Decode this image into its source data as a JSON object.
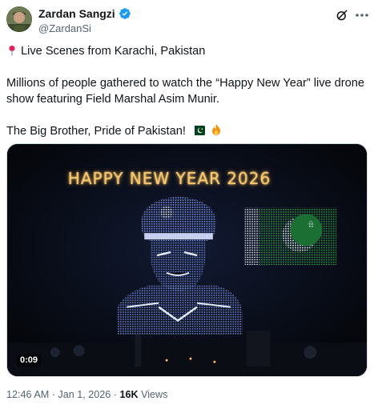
{
  "author": {
    "display_name": "Zardan Sangzi",
    "handle": "@ZardanSi",
    "avatar_icon": "avatar-portrait",
    "verified_icon": "verified-badge-icon",
    "verified_color": "#1d9bf0"
  },
  "actions": {
    "grok_icon": "grok-icon",
    "more_icon": "more-options-icon"
  },
  "post": {
    "line1": "Live Scenes from Karachi, Pakistan",
    "line2": "Millions of people gathered to watch the “Happy New Year” live drone",
    "line3": "show featuring Field Marshal Asim Munir.",
    "line4": "The Big Brother, Pride of Pakistan!",
    "emojis": [
      "pakistan-flag-emoji",
      "fire-emoji"
    ]
  },
  "media": {
    "drone_text": "HAPPY NEW YEAR 2026",
    "duration": "0:09"
  },
  "footer": {
    "time": "12:46 AM",
    "separator": "·",
    "date": "Jan 1, 2026",
    "views_count": "16K",
    "views_label": "Views"
  },
  "colors": {
    "accent": "#1d9bf0",
    "text_primary": "#0f1419",
    "text_secondary": "#536471",
    "drone_blue": "#6f8cff",
    "drone_gold": "#f7c86c",
    "flag_green": "#1f8a3a"
  }
}
